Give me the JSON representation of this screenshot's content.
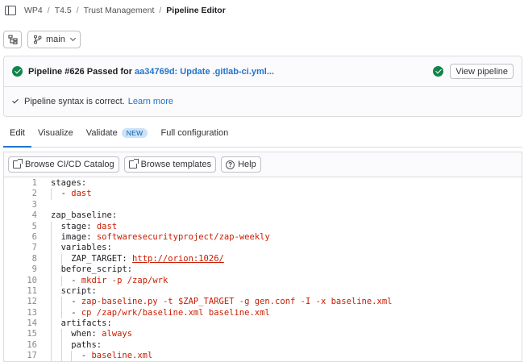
{
  "breadcrumb": {
    "items": [
      "WP4",
      "T4.5",
      "Trust Management",
      "Pipeline Editor"
    ],
    "separator": "/"
  },
  "toolbar": {
    "branch_label": "main"
  },
  "pipeline_status": {
    "prefix": "Pipeline #626 Passed for",
    "commit_link": "aa34769d: Update .gitlab-ci.yml...",
    "view_button": "View pipeline",
    "syntax_message": "Pipeline syntax is correct.",
    "learn_more": "Learn more"
  },
  "tabs": [
    {
      "label": "Edit",
      "active": true
    },
    {
      "label": "Visualize",
      "active": false
    },
    {
      "label": "Validate",
      "active": false,
      "badge": "NEW"
    },
    {
      "label": "Full configuration",
      "active": false
    }
  ],
  "editor_toolbar": {
    "catalog_button": "Browse CI/CD Catalog",
    "templates_button": "Browse templates",
    "help_button": "Help"
  },
  "code_lines": [
    {
      "n": "1",
      "indent": 0,
      "parts": [
        [
          "k",
          "stages:"
        ]
      ]
    },
    {
      "n": "2",
      "indent": 1,
      "parts": [
        [
          "k",
          "- "
        ],
        [
          "v",
          "dast"
        ]
      ]
    },
    {
      "n": "3",
      "indent": 0,
      "parts": []
    },
    {
      "n": "4",
      "indent": 0,
      "parts": [
        [
          "k",
          "zap_baseline:"
        ]
      ]
    },
    {
      "n": "5",
      "indent": 1,
      "parts": [
        [
          "k",
          "stage: "
        ],
        [
          "v",
          "dast"
        ]
      ]
    },
    {
      "n": "6",
      "indent": 1,
      "parts": [
        [
          "k",
          "image: "
        ],
        [
          "v",
          "softwaresecurityproject/zap-weekly"
        ]
      ]
    },
    {
      "n": "7",
      "indent": 1,
      "parts": [
        [
          "k",
          "variables:"
        ]
      ]
    },
    {
      "n": "8",
      "indent": 2,
      "parts": [
        [
          "k",
          "ZAP_TARGET: "
        ],
        [
          "u",
          "http://orion:1026/"
        ]
      ]
    },
    {
      "n": "9",
      "indent": 1,
      "parts": [
        [
          "k",
          "before_script:"
        ]
      ]
    },
    {
      "n": "10",
      "indent": 2,
      "parts": [
        [
          "k",
          "- "
        ],
        [
          "v",
          "mkdir -p /zap/wrk"
        ]
      ]
    },
    {
      "n": "11",
      "indent": 1,
      "parts": [
        [
          "k",
          "script:"
        ]
      ]
    },
    {
      "n": "12",
      "indent": 2,
      "parts": [
        [
          "k",
          "- "
        ],
        [
          "v",
          "zap-baseline.py -t $ZAP_TARGET -g gen.conf -I -x baseline.xml"
        ]
      ]
    },
    {
      "n": "13",
      "indent": 2,
      "parts": [
        [
          "k",
          "- "
        ],
        [
          "v",
          "cp /zap/wrk/baseline.xml baseline.xml"
        ]
      ]
    },
    {
      "n": "14",
      "indent": 1,
      "parts": [
        [
          "k",
          "artifacts:"
        ]
      ]
    },
    {
      "n": "15",
      "indent": 2,
      "parts": [
        [
          "k",
          "when: "
        ],
        [
          "v",
          "always"
        ]
      ]
    },
    {
      "n": "16",
      "indent": 2,
      "parts": [
        [
          "k",
          "paths:"
        ]
      ]
    },
    {
      "n": "17",
      "indent": 3,
      "parts": [
        [
          "k",
          "- "
        ],
        [
          "v",
          "baseline.xml"
        ]
      ]
    }
  ],
  "colors": {
    "accent": "#1f75cb",
    "success": "#108548",
    "code_value": "#c91c00"
  }
}
